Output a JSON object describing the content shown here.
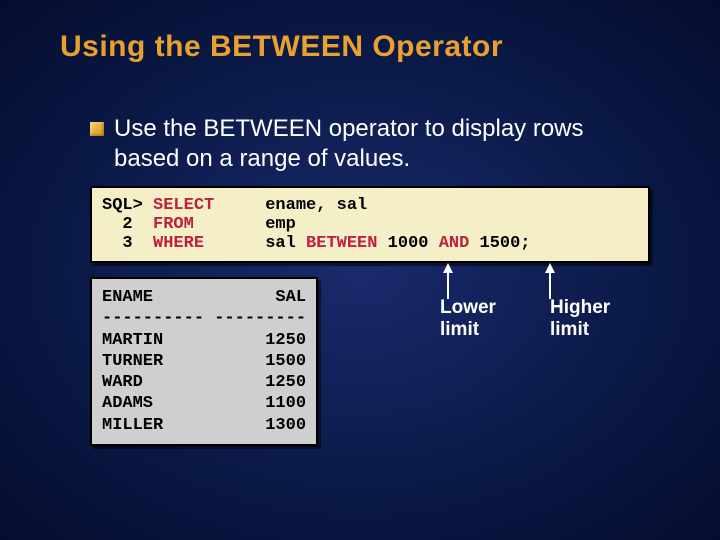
{
  "title": "Using the BETWEEN Operator",
  "bullet": "Use the BETWEEN operator to display rows based on a range of values.",
  "sql": {
    "line1_prompt": "SQL> ",
    "line1_kw": "SELECT",
    "line1_rest": "\tename, sal",
    "line2_prompt": "  2  ",
    "line2_kw": "FROM",
    "line2_rest": "\temp",
    "line3_prompt": "  3  ",
    "line3_kw": "WHERE",
    "line3_rest_a": "\tsal ",
    "line3_kw2": "BETWEEN",
    "line3_rest_b": " 1000 ",
    "line3_kw3": "AND",
    "line3_rest_c": " 1500;"
  },
  "results": {
    "header": "ENAME            SAL",
    "divider": "---------- ---------",
    "rows": [
      "MARTIN          1250",
      "TURNER          1500",
      "WARD            1250",
      "ADAMS           1100",
      "MILLER          1300"
    ]
  },
  "annotations": {
    "lower_line1": "Lower",
    "lower_line2": "limit",
    "higher_line1": "Higher",
    "higher_line2": "limit"
  },
  "chart_data": {
    "type": "table",
    "title": "Using the BETWEEN Operator",
    "sql_query": "SELECT ename, sal FROM emp WHERE sal BETWEEN 1000 AND 1500;",
    "columns": [
      "ENAME",
      "SAL"
    ],
    "rows": [
      {
        "ENAME": "MARTIN",
        "SAL": 1250
      },
      {
        "ENAME": "TURNER",
        "SAL": 1500
      },
      {
        "ENAME": "WARD",
        "SAL": 1250
      },
      {
        "ENAME": "ADAMS",
        "SAL": 1100
      },
      {
        "ENAME": "MILLER",
        "SAL": 1300
      }
    ],
    "range": {
      "lower_limit": 1000,
      "higher_limit": 1500
    }
  }
}
